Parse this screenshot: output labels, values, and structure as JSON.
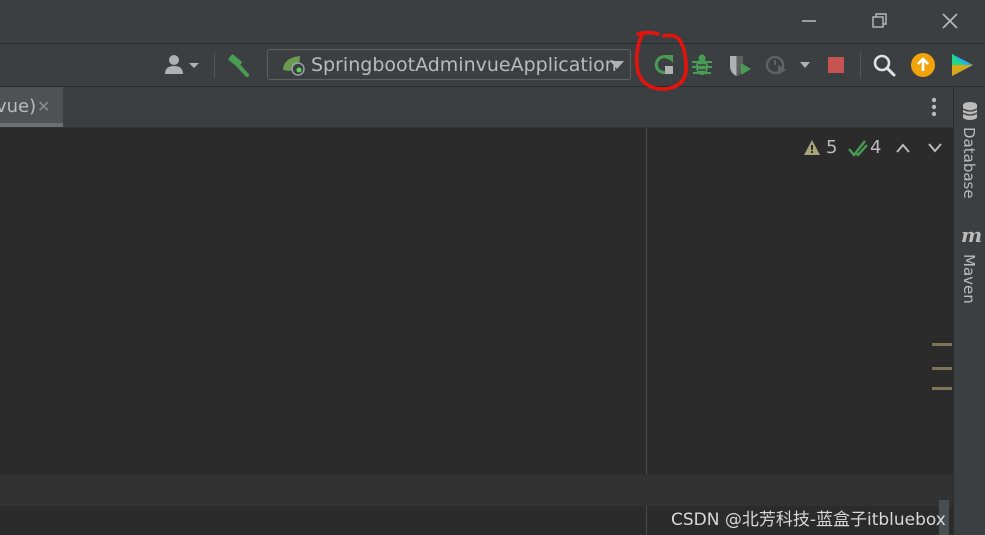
{
  "run_config": {
    "name": "SpringbootAdminvueApplication"
  },
  "editor_tab": {
    "label": "vue)",
    "close_glyph": "✕"
  },
  "inspections": {
    "warnings": "5",
    "passed": "4"
  },
  "tool_windows": {
    "database": "Database",
    "maven_letter": "m",
    "maven": "Maven"
  },
  "watermark": "CSDN @北芳科技-蓝盒子itbluebox",
  "icons": {
    "user": "user-icon",
    "build": "hammer-icon",
    "rerun": "rerun-icon",
    "debug": "bug-icon",
    "coverage": "coverage-icon",
    "profile": "profiler-icon",
    "stop": "stop-icon",
    "search": "search-icon",
    "update": "update-icon",
    "plugin": "toolbox-icon"
  },
  "colors": {
    "accent_green": "#499c54",
    "stop_red": "#c75450",
    "update_orange": "#f0a30a",
    "annotation_red": "#e8120c"
  }
}
